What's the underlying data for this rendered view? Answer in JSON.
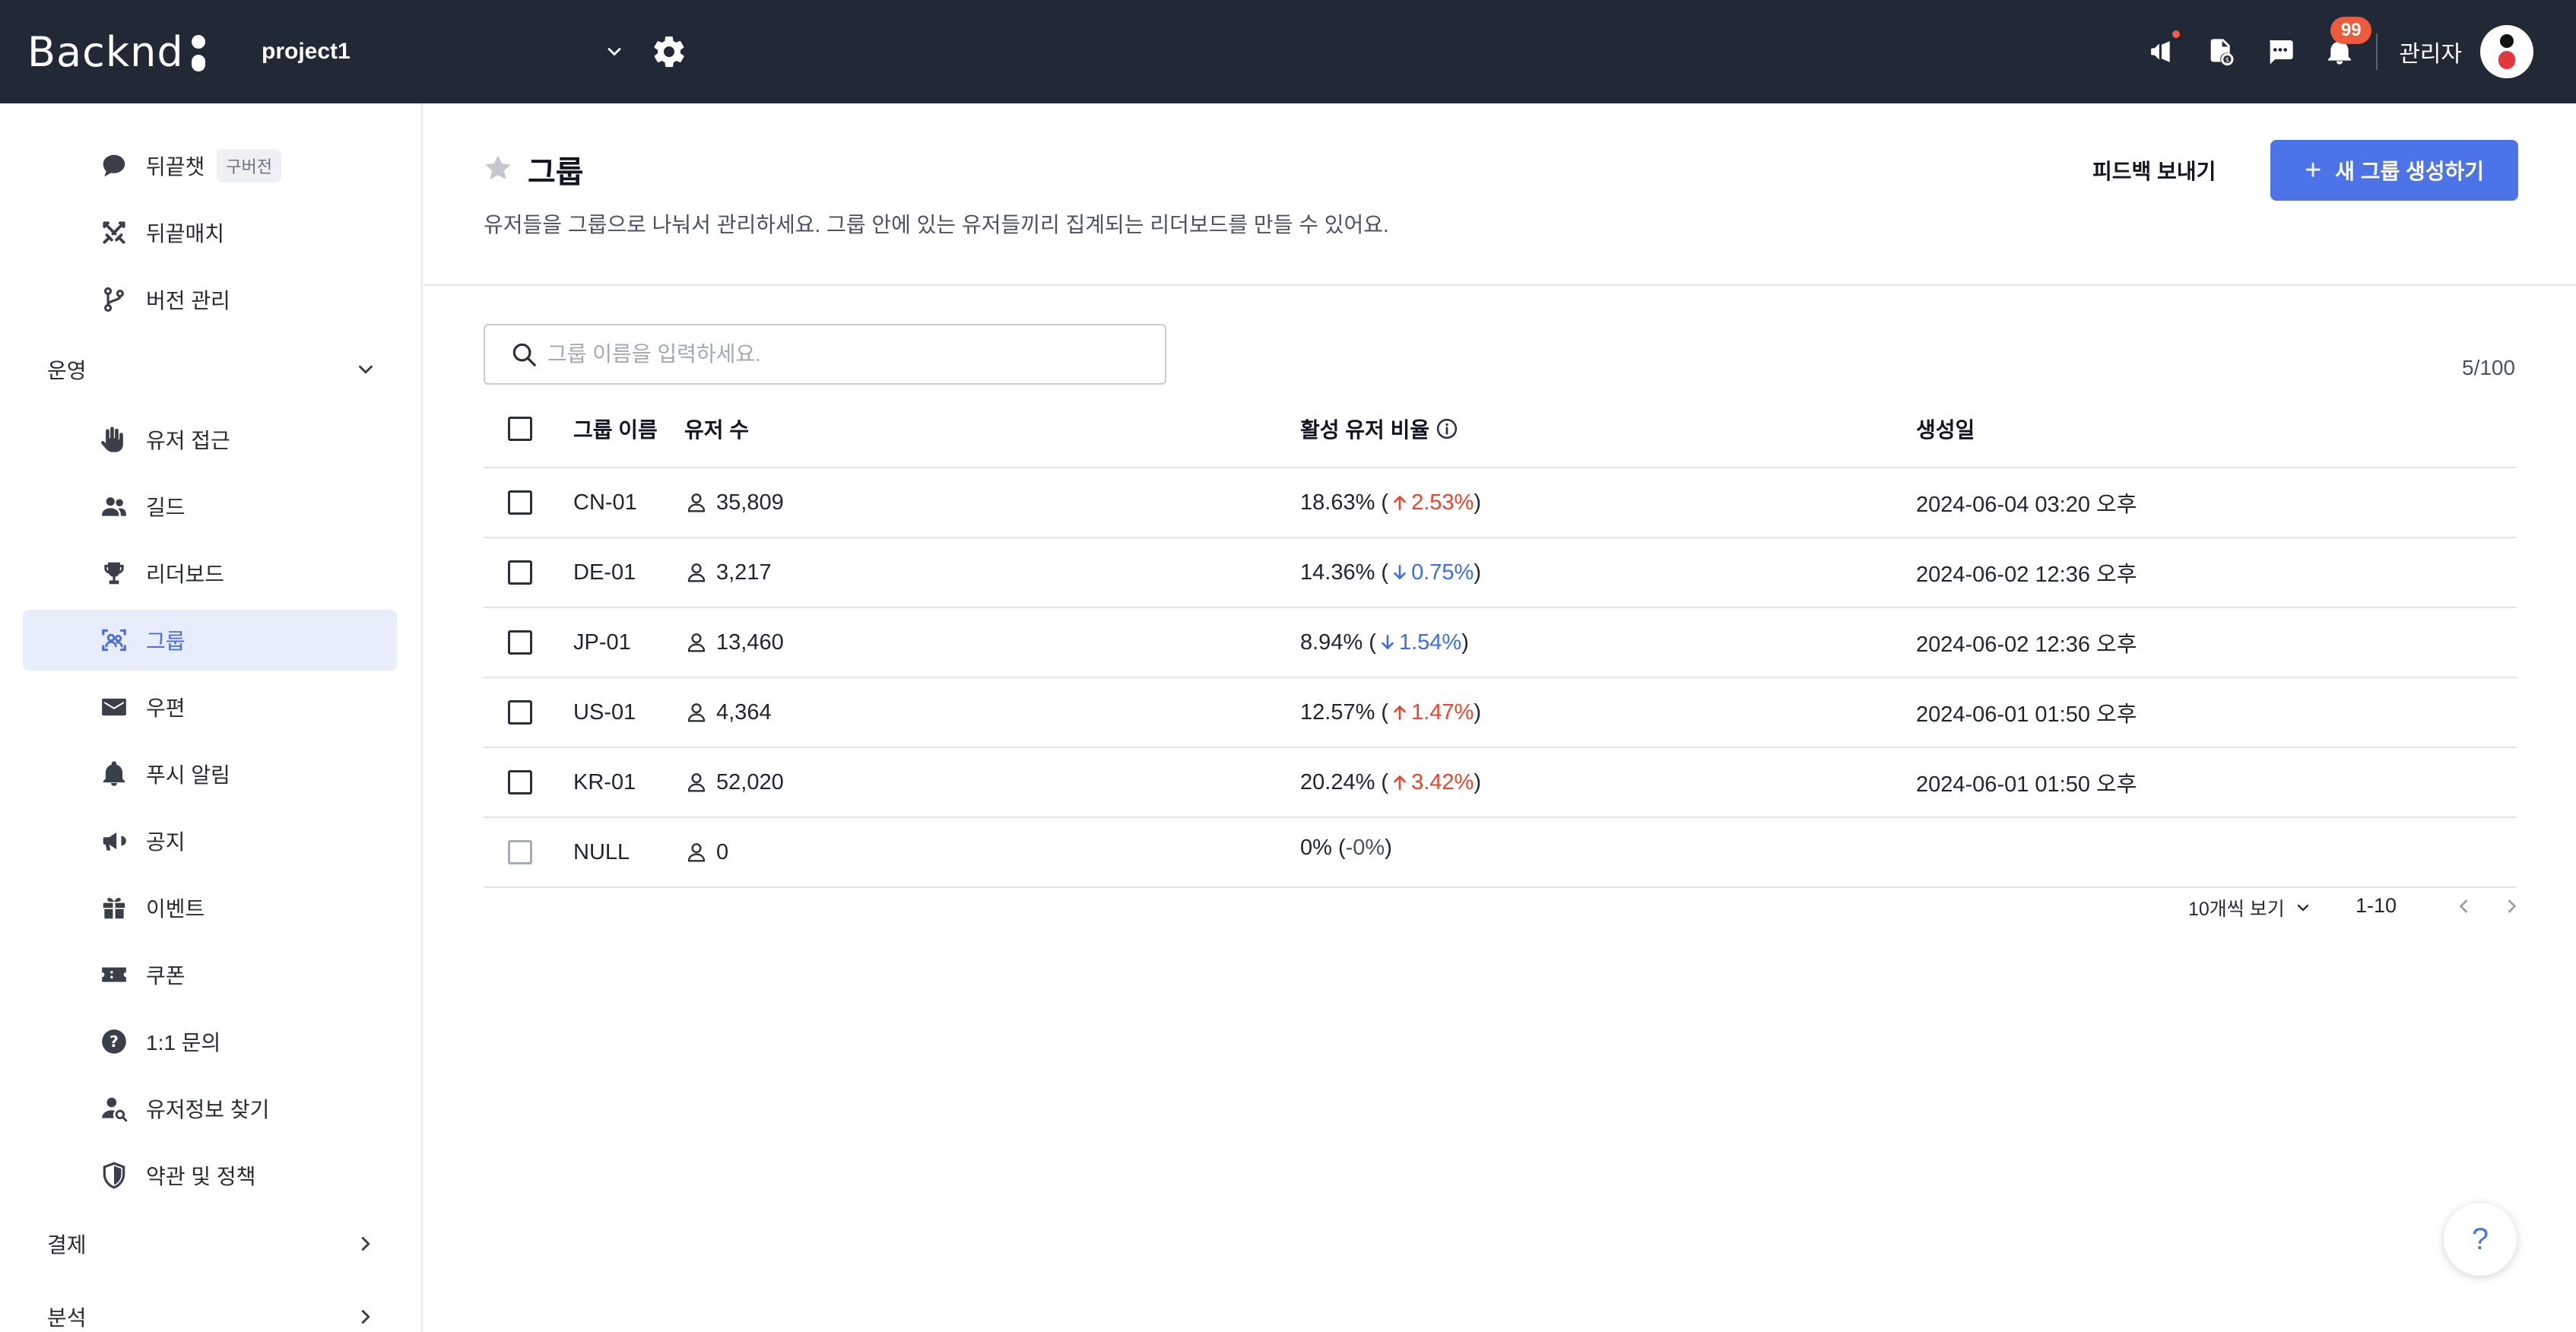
{
  "app": {
    "logo_text": "Backnd",
    "project": "project1",
    "user_name": "관리자",
    "notification_count": "99"
  },
  "sidebar": {
    "items_top": [
      {
        "label": "뒤끝챗",
        "tag": "구버전",
        "icon": "chat-bubble-icon"
      },
      {
        "label": "뒤끝매치",
        "icon": "swords-icon"
      },
      {
        "label": "버전 관리",
        "icon": "branch-icon"
      }
    ],
    "section_ops": "운영",
    "items_ops": [
      {
        "label": "유저 접근",
        "icon": "hand-icon"
      },
      {
        "label": "길드",
        "icon": "people-icon"
      },
      {
        "label": "리더보드",
        "icon": "trophy-icon"
      },
      {
        "label": "그룹",
        "icon": "group-icon",
        "active": true
      },
      {
        "label": "우편",
        "icon": "mail-icon"
      },
      {
        "label": "푸시 알림",
        "icon": "bell-icon"
      },
      {
        "label": "공지",
        "icon": "megaphone-icon"
      },
      {
        "label": "이벤트",
        "icon": "gift-icon"
      },
      {
        "label": "쿠폰",
        "icon": "ticket-icon"
      },
      {
        "label": "1:1 문의",
        "icon": "question-icon"
      },
      {
        "label": "유저정보 찾기",
        "icon": "user-search-icon"
      },
      {
        "label": "약관 및 정책",
        "icon": "shield-icon"
      }
    ],
    "section_payment": "결제",
    "section_analytics": "분석"
  },
  "page": {
    "title": "그룹",
    "description": "유저들을 그룹으로 나눠서 관리하세요. 그룹 안에 있는 유저들끼리 집계되는 리더보드를 만들 수 있어요.",
    "feedback_label": "피드백 보내기",
    "create_label": "새 그룹 생성하기",
    "search_placeholder": "그룹 이름을 입력하세요.",
    "count": "5/100"
  },
  "table": {
    "headers": {
      "name": "그룹 이름",
      "users": "유저 수",
      "active": "활성 유저 비율",
      "created": "생성일"
    },
    "rows": [
      {
        "name": "CN-01",
        "users": "35,809",
        "ratio": "18.63% (",
        "change": "2.53%",
        "close": ")",
        "dir": "up",
        "created": "2024-06-04 03:20 오후"
      },
      {
        "name": "DE-01",
        "users": "3,217",
        "ratio": "14.36% (",
        "change": "0.75%",
        "close": ")",
        "dir": "down",
        "created": "2024-06-02 12:36 오후"
      },
      {
        "name": "JP-01",
        "users": "13,460",
        "ratio": "8.94% (",
        "change": "1.54%",
        "close": ")",
        "dir": "down",
        "created": "2024-06-02 12:36 오후"
      },
      {
        "name": "US-01",
        "users": "4,364",
        "ratio": "12.57% (",
        "change": "1.47%",
        "close": ")",
        "dir": "up",
        "created": "2024-06-01 01:50 오후"
      },
      {
        "name": "KR-01",
        "users": "52,020",
        "ratio": "20.24% (",
        "change": "3.42%",
        "close": ")",
        "dir": "up",
        "created": "2024-06-01 01:50 오후"
      },
      {
        "name": "NULL",
        "users": "0",
        "ratio": "0% (",
        "change": "-0%",
        "close": ")",
        "dir": "none",
        "created": ""
      }
    ]
  },
  "pagination": {
    "per_page": "10개씩 보기",
    "range": "1-10"
  },
  "help": {
    "label": "?"
  },
  "colors": {
    "topbar": "#212836",
    "accent": "#4d73e8",
    "up": "#e5472e",
    "down": "#3b6ee8",
    "active_bg": "#e8edfc",
    "badge": "#ee5a3c"
  }
}
